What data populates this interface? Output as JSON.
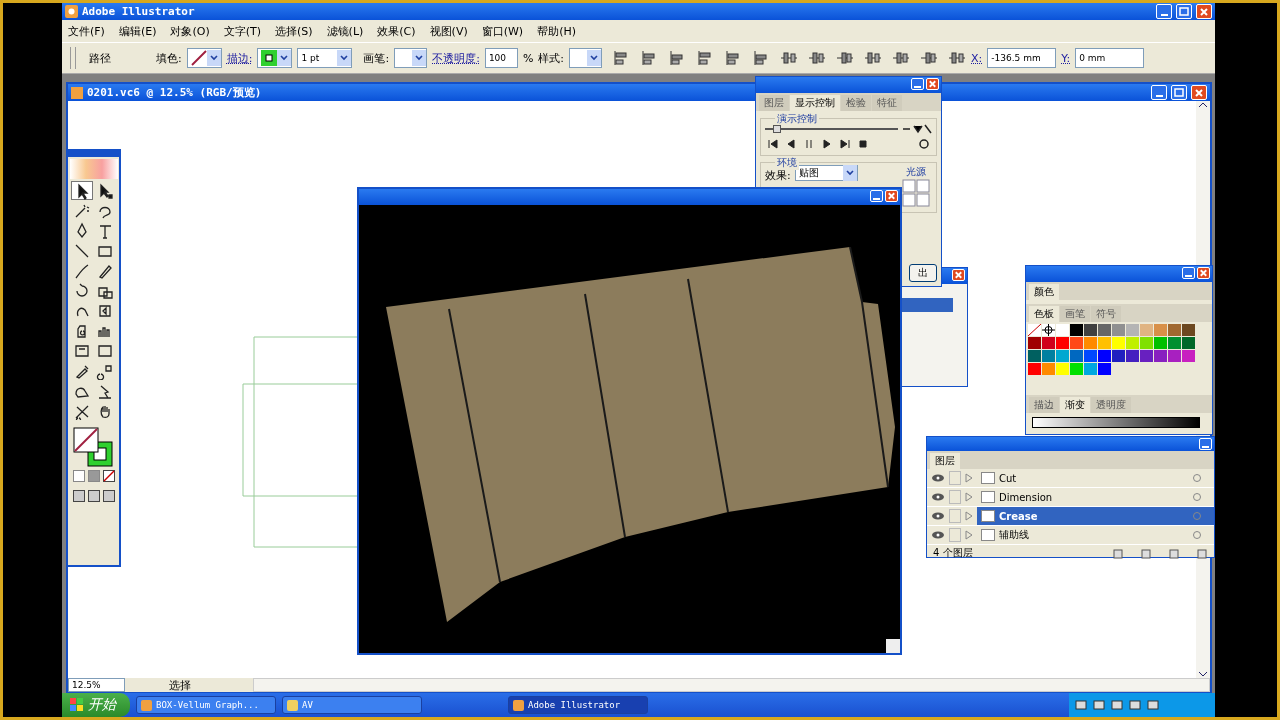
{
  "app_window": {
    "title": "Adobe Illustrator"
  },
  "menu": [
    "文件(F)",
    "编辑(E)",
    "对象(O)",
    "文字(T)",
    "选择(S)",
    "滤镜(L)",
    "效果(C)",
    "视图(V)",
    "窗口(W)",
    "帮助(H)"
  ],
  "control_bar": {
    "selection_label": "路径",
    "fill_label": "填色:",
    "stroke_label": "描边:",
    "stroke_weight": "1 pt",
    "brush_label": "画笔:",
    "opacity_label": "不透明度:",
    "opacity_value": "100",
    "percent": "%",
    "style_label": "样式:",
    "x_label": "X:",
    "x_value": "-136.5 mm",
    "y_label": "Y:",
    "y_value": "0 mm"
  },
  "document_window": {
    "title": "0201.vc6 @ 12.5% (RGB/预览)",
    "zoom": "12.5%",
    "status": "选择"
  },
  "toolbox": {
    "tools": [
      {
        "selected": true
      },
      {
        "selected": false
      },
      {
        "selected": false
      },
      {
        "selected": false
      },
      {
        "selected": false
      },
      {
        "selected": false
      },
      {
        "selected": false
      },
      {
        "selected": false
      },
      {
        "selected": false
      },
      {
        "selected": false
      },
      {
        "selected": false
      },
      {
        "selected": false
      },
      {
        "selected": false
      },
      {
        "selected": false
      },
      {
        "selected": false
      },
      {
        "selected": false
      },
      {
        "selected": false
      },
      {
        "selected": false
      },
      {
        "selected": false
      },
      {
        "selected": false
      },
      {
        "selected": false
      },
      {
        "selected": false
      },
      {
        "selected": false
      },
      {
        "selected": false
      }
    ]
  },
  "display_panel": {
    "tabs": [
      {
        "label": "图层",
        "selected": false
      },
      {
        "label": "显示控制",
        "selected": true
      },
      {
        "label": "检验",
        "selected": false
      },
      {
        "label": "特征",
        "selected": false
      }
    ],
    "group_title": "演示控制",
    "playback": {
      "level": 0.06
    },
    "environment_title": "环境",
    "effect_label": "效果:",
    "effect_value": "贴图",
    "light_title": "光源",
    "output_button": "出"
  },
  "color_panel": {
    "tab": "颜色",
    "swatch_tabs": [
      {
        "label": "色板",
        "selected": true
      },
      {
        "label": "画笔",
        "selected": false
      },
      {
        "label": "符号",
        "selected": false
      }
    ],
    "swatches": [
      {
        "kind": "none"
      },
      {
        "kind": "registration"
      },
      {
        "kind": "color",
        "color": "#ffffff"
      },
      {
        "kind": "color",
        "color": "#000000"
      },
      {
        "kind": "color",
        "color": "#404040"
      },
      {
        "kind": "color",
        "color": "#666666"
      },
      {
        "kind": "color",
        "color": "#909090"
      },
      {
        "kind": "color",
        "color": "#b4b4b4"
      },
      {
        "kind": "color",
        "color": "#e0b482"
      },
      {
        "kind": "color",
        "color": "#d89048"
      },
      {
        "kind": "color",
        "color": "#a06830"
      },
      {
        "kind": "color",
        "color": "#6c4820"
      },
      {
        "kind": "color",
        "color": "#a00000"
      },
      {
        "kind": "color",
        "color": "#d0001a"
      },
      {
        "kind": "color",
        "color": "#ff0000"
      },
      {
        "kind": "color",
        "color": "#ff4818"
      },
      {
        "kind": "color",
        "color": "#ff8a00"
      },
      {
        "kind": "color",
        "color": "#ffc000"
      },
      {
        "kind": "color",
        "color": "#ffff00"
      },
      {
        "kind": "color",
        "color": "#c0f000"
      },
      {
        "kind": "color",
        "color": "#80e000"
      },
      {
        "kind": "color",
        "color": "#00c000"
      },
      {
        "kind": "color",
        "color": "#009030"
      },
      {
        "kind": "color",
        "color": "#006828"
      },
      {
        "kind": "color",
        "color": "#006060"
      },
      {
        "kind": "color",
        "color": "#0080a0"
      },
      {
        "kind": "color",
        "color": "#00a8d0"
      },
      {
        "kind": "color",
        "color": "#0068c0"
      },
      {
        "kind": "color",
        "color": "#0048ff"
      },
      {
        "kind": "color",
        "color": "#0000ff"
      },
      {
        "kind": "color",
        "color": "#2020c0"
      },
      {
        "kind": "color",
        "color": "#4420c0"
      },
      {
        "kind": "color",
        "color": "#6820c0"
      },
      {
        "kind": "color",
        "color": "#8820c0"
      },
      {
        "kind": "color",
        "color": "#a820c0"
      },
      {
        "kind": "color",
        "color": "#c820c0"
      },
      {
        "kind": "color",
        "color": "#ff0000"
      },
      {
        "kind": "color",
        "color": "#ff8a00"
      },
      {
        "kind": "color",
        "color": "#ffff00"
      },
      {
        "kind": "color",
        "color": "#00e000"
      },
      {
        "kind": "color",
        "color": "#00a8e0"
      },
      {
        "kind": "color",
        "color": "#0000ff"
      }
    ],
    "lower_tabs": [
      {
        "label": "描边",
        "selected": false
      },
      {
        "label": "渐变",
        "selected": true
      },
      {
        "label": "透明度",
        "selected": false
      }
    ]
  },
  "layers_panel": {
    "tab": "图层",
    "layers": [
      {
        "name": "Cut",
        "visible": true,
        "selected": false
      },
      {
        "name": "Dimension",
        "visible": true,
        "selected": false
      },
      {
        "name": "Crease",
        "visible": true,
        "selected": true
      },
      {
        "name": "辅助线",
        "visible": true,
        "selected": false
      }
    ],
    "count": "4 个图层"
  },
  "taskbar": {
    "start": "开始",
    "tasks": [
      {
        "label": "BOX-Vellum Graph...",
        "selected": false
      },
      {
        "label": "AV",
        "selected": false
      },
      {
        "label": "Adobe Illustrator",
        "selected": true
      }
    ]
  }
}
